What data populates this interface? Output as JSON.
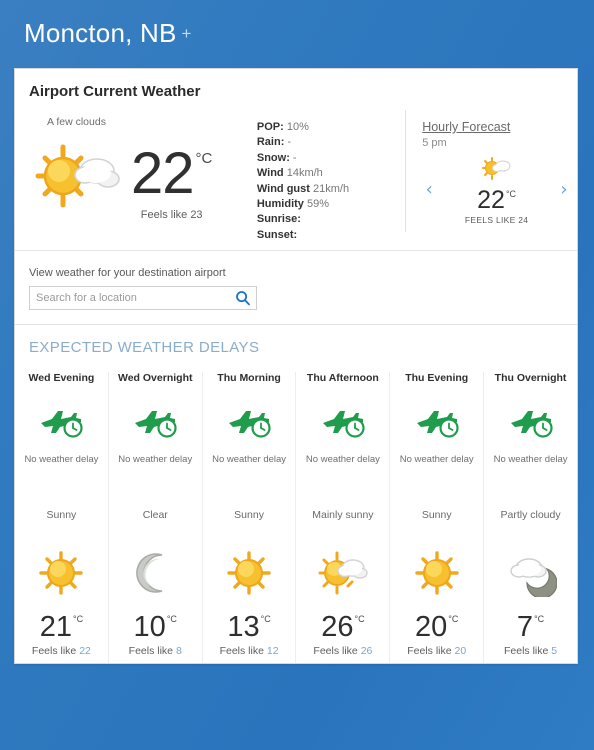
{
  "header": {
    "city": "Moncton, NB",
    "add_icon": "+"
  },
  "card": {
    "title": "Airport Current Weather"
  },
  "current": {
    "condition": "A few clouds",
    "icon": "sun-behind-cloud-icon",
    "temperature": "22",
    "unit": "°C",
    "feels_like": "Feels like 23",
    "details": [
      {
        "key": "POP:",
        "value": "10%"
      },
      {
        "key": "Rain:",
        "value": "-"
      },
      {
        "key": "Snow:",
        "value": "-"
      },
      {
        "key": "Wind",
        "value": "14km/h"
      },
      {
        "key": "Wind gust",
        "value": "21km/h"
      },
      {
        "key": "Humidity",
        "value": "59%"
      },
      {
        "key": "Sunrise:",
        "value": ""
      },
      {
        "key": "Sunset:",
        "value": ""
      }
    ]
  },
  "hourly": {
    "link_label": "Hourly Forecast",
    "time": "5 pm",
    "icon": "sun-behind-cloud-icon",
    "temperature": "22",
    "unit": "°C",
    "feels_like": "FEELS LIKE 24",
    "prev_icon": "‹",
    "next_icon": "›"
  },
  "search": {
    "label": "View weather for your destination airport",
    "placeholder": "Search for a location",
    "value": "",
    "icon": "search-icon"
  },
  "delays": {
    "title": "EXPECTED WEATHER DELAYS",
    "columns": [
      {
        "period": "Wed Evening",
        "delay_icon": "plane-clock-icon",
        "delay_text": "No weather delay",
        "condition": "Sunny",
        "icon": "sun-icon",
        "temperature": "21",
        "unit": "°C",
        "feels_prefix": "Feels like",
        "feels_value": "22"
      },
      {
        "period": "Wed Overnight",
        "delay_icon": "plane-clock-icon",
        "delay_text": "No weather delay",
        "condition": "Clear",
        "icon": "moon-icon",
        "temperature": "10",
        "unit": "°C",
        "feels_prefix": "Feels like",
        "feels_value": "8"
      },
      {
        "period": "Thu Morning",
        "delay_icon": "plane-clock-icon",
        "delay_text": "No weather delay",
        "condition": "Sunny",
        "icon": "sun-icon",
        "temperature": "13",
        "unit": "°C",
        "feels_prefix": "Feels like",
        "feels_value": "12"
      },
      {
        "period": "Thu Afternoon",
        "delay_icon": "plane-clock-icon",
        "delay_text": "No weather delay",
        "condition": "Mainly sunny",
        "icon": "sun-behind-cloud-icon",
        "temperature": "26",
        "unit": "°C",
        "feels_prefix": "Feels like",
        "feels_value": "26"
      },
      {
        "period": "Thu Evening",
        "delay_icon": "plane-clock-icon",
        "delay_text": "No weather delay",
        "condition": "Sunny",
        "icon": "sun-icon",
        "temperature": "20",
        "unit": "°C",
        "feels_prefix": "Feels like",
        "feels_value": "20"
      },
      {
        "period": "Thu Overnight",
        "delay_icon": "plane-clock-icon",
        "delay_text": "No weather delay",
        "condition": "Partly cloudy",
        "icon": "moon-behind-cloud-icon",
        "temperature": "7",
        "unit": "°C",
        "feels_prefix": "Feels like",
        "feels_value": "5"
      }
    ]
  },
  "colors": {
    "background_blue": "#2f79bf",
    "accent_blue": "#6aa6dd",
    "heading_blue": "#8badc9",
    "delay_green": "#1f9d4d",
    "sun_yellow": "#f5b324"
  }
}
